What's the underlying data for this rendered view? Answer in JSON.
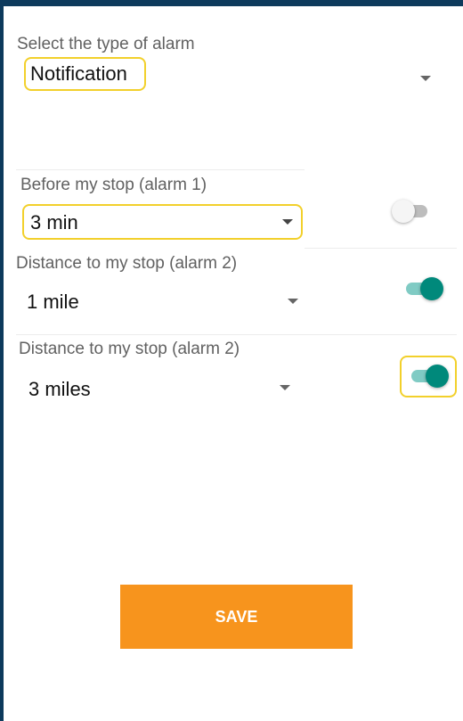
{
  "alarm_type": {
    "label": "Select the type of alarm",
    "value": "Notification"
  },
  "alarms": [
    {
      "label": "Before my stop (alarm 1)",
      "value": "3 min",
      "enabled": false
    },
    {
      "label": "Distance to my stop (alarm 2)",
      "value": "1 mile",
      "enabled": true
    },
    {
      "label": "Distance to my stop (alarm 2)",
      "value": "3 miles",
      "enabled": true
    }
  ],
  "save_button": {
    "label": "SAVE"
  },
  "colors": {
    "frame": "#0d3a5c",
    "accent": "#00897b",
    "save": "#f7941d",
    "highlight": "#f2d02b"
  }
}
